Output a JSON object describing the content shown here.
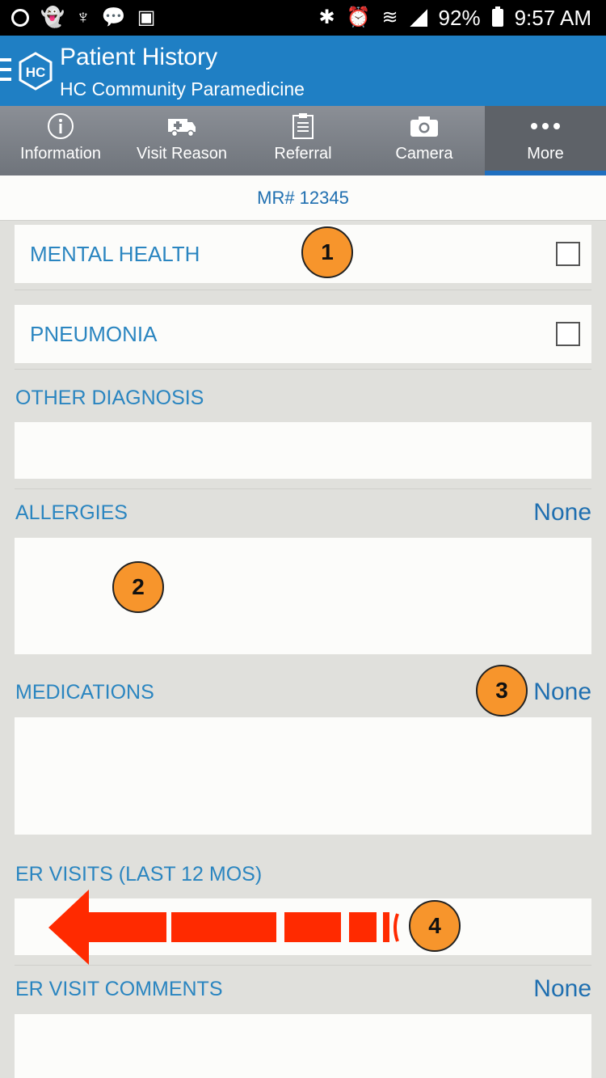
{
  "status_bar": {
    "battery": "92%",
    "time": "9:57 AM"
  },
  "app_bar": {
    "title": "Patient History",
    "subtitle": "HC Community Paramedicine",
    "logo_text": "HC"
  },
  "tabs": [
    {
      "label": "Information",
      "icon": "info-icon"
    },
    {
      "label": "Visit Reason",
      "icon": "ambulance-icon"
    },
    {
      "label": "Referral",
      "icon": "clipboard-icon"
    },
    {
      "label": "Camera",
      "icon": "camera-icon"
    },
    {
      "label": "More",
      "icon": "more-icon",
      "active": true
    }
  ],
  "record": {
    "mr_number": "MR# 12345"
  },
  "diagnosis_items": [
    {
      "label": "MENTAL HEALTH",
      "checked": false
    },
    {
      "label": "PNEUMONIA",
      "checked": false
    }
  ],
  "sections": {
    "other_diagnosis": {
      "label": "OTHER DIAGNOSIS",
      "value": ""
    },
    "allergies": {
      "label": "ALLERGIES",
      "value": "None"
    },
    "medications": {
      "label": "MEDICATIONS",
      "value": "None"
    },
    "er_visits": {
      "label": "ER VISITS (LAST 12 MOS)",
      "value": ""
    },
    "er_visit_comments": {
      "label": "ER VISIT COMMENTS",
      "value": "None"
    }
  },
  "callouts": [
    "1",
    "2",
    "3",
    "4"
  ],
  "colors": {
    "app_bar": "#1f7fc4",
    "accent_text": "#2a85c0",
    "callout": "#f7952c",
    "arrow": "#ff2a00"
  }
}
